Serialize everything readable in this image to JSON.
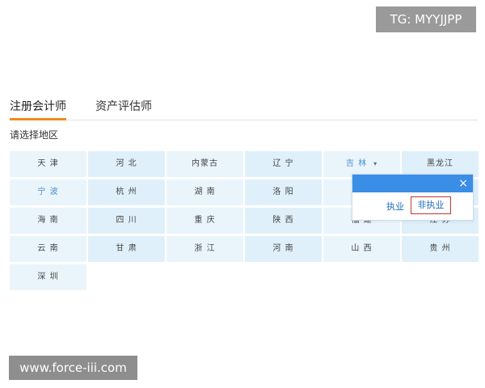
{
  "watermarks": {
    "top": "TG: MYYJJPP",
    "bottom": "www.force-iii.com"
  },
  "tabs": [
    {
      "label": "注册会计师",
      "active": true
    },
    {
      "label": "资产评估师",
      "active": false
    }
  ],
  "region_label": "请选择地区",
  "regions": [
    [
      "天 津",
      "河 北",
      "内蒙古",
      "辽 宁",
      "吉 林",
      "黑龙江"
    ],
    [
      "宁 波",
      "杭 州",
      "湖 南",
      "洛 阳",
      "",
      ""
    ],
    [
      "海 南",
      "四 川",
      "重 庆",
      "陕 西",
      "福 建",
      "江 苏"
    ],
    [
      "云 南",
      "甘 肃",
      "浙 江",
      "河 南",
      "山 西",
      "贵 州"
    ],
    [
      "深 圳"
    ]
  ],
  "dropdown_arrow": "▾",
  "popup": {
    "close": "×",
    "options": [
      "执业",
      "非执业"
    ]
  },
  "colors": {
    "accent_orange": "#f08a1a",
    "popup_blue": "#3a8ee6",
    "highlight_red": "#c0392b"
  }
}
